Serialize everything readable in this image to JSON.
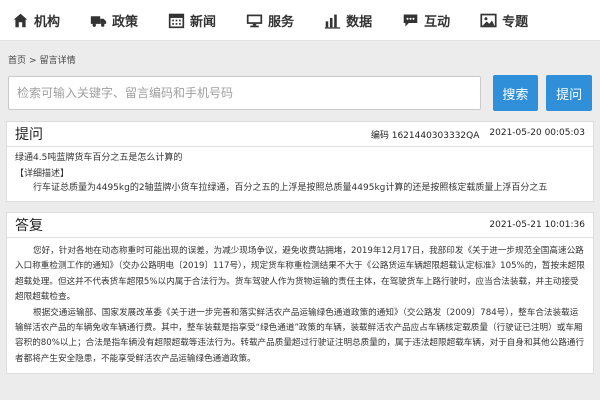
{
  "nav": [
    {
      "label": "机构",
      "icon": "home-icon"
    },
    {
      "label": "政策",
      "icon": "truck-icon"
    },
    {
      "label": "新闻",
      "icon": "calendar-icon"
    },
    {
      "label": "服务",
      "icon": "monitor-icon"
    },
    {
      "label": "数据",
      "icon": "bar-chart-icon"
    },
    {
      "label": "互动",
      "icon": "chat-icon"
    },
    {
      "label": "专题",
      "icon": "image-icon"
    }
  ],
  "breadcrumb": {
    "home": "首页",
    "separator": ">",
    "current": "留言详情"
  },
  "search": {
    "placeholder": "检索可输入关键字、留言编码和手机号码",
    "search_label": "搜索",
    "ask_label": "提问"
  },
  "question": {
    "title": "提问",
    "code_label": "编码",
    "code": "1621440303332QA",
    "datetime": "2021-05-20 00:05:03",
    "subject": "绿通4.5吨蓝牌货车百分之五是怎么计算的",
    "detail_label": "【详细描述】",
    "detail": "行车证总质量为4495kg的2轴蓝牌小货车拉绿通，百分之五的上浮是按照总质量4495kg计算的还是按照核定载质量上浮百分之五"
  },
  "answer": {
    "title": "答复",
    "datetime": "2021-05-21 10:01:36",
    "para1": "您好，针对各地在动态称重时可能出现的误差，为减少现场争议，避免收费站拥堵，2019年12月17日，我部印发《关于进一步规范全国高速公路入口称重检测工作的通知》（交办公路明电〔2019〕117号），规定货车称重检测结果不大于《公路货运车辆超限超载认定标准》105%的，暂按未超限超载处理。但这并不代表货车超限5%以内属于合法行为。货车驾驶人作为货物运输的责任主体，在驾驶货车上路行驶时，应当合法装载，并主动接受超限超载检查。",
    "para2": "根据交通运输部、国家发展改革委《关于进一步完善和落实鲜活农产品运输绿色通道政策的通知》（交公路发〔2009〕784号），整车合法装载运输鲜活农产品的车辆免收车辆通行费。其中，整车装载是指享受“绿色通道”政策的车辆，装载鲜活农产品应占车辆核定载质量（行驶证已注明）或车厢容积的80%以上；合法是指车辆没有超限超载等违法行为。转载产品质量超过行驶证注明总质量的，属于违法超限超载车辆，对于自身和其他公路通行者都将产生安全隐患，不能享受鲜活农产品运输绿色通道政策。"
  }
}
